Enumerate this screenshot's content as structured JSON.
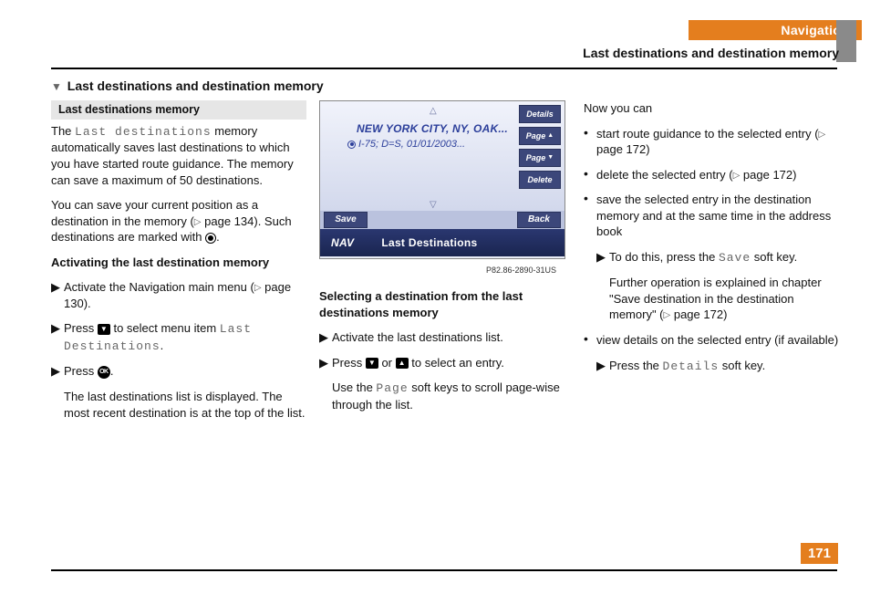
{
  "header": {
    "nav": "Navigation",
    "sub": "Last destinations and destination memory"
  },
  "section_title": "Last destinations and destination memory",
  "col1": {
    "subhead": "Last destinations memory",
    "p1_a": "The ",
    "p1_mono": "Last destinations",
    "p1_b": " memory automatically saves last destinations to which you have started route guidance. The memory can save a maximum of 50 destinations.",
    "p2_a": "You can save your current position as a destination in the memory (",
    "p2_page": "page 134",
    "p2_b": "). Such destinations are marked with ",
    "h2": "Activating the last destination memory",
    "s1_a": "Activate the Navigation main menu (",
    "s1_page": "page 130",
    "s1_b": ").",
    "s2_a": "Press ",
    "s2_b": " to select menu item ",
    "s2_mono": "Last Destinations",
    "s3_a": "Press ",
    "s4": "The last destinations list is displayed. The most recent destination is at the top of the list."
  },
  "fig": {
    "line1": "NEW YORK CITY, NY, OAK...",
    "line2": "I-75; D=S, 01/01/2003...",
    "k_details": "Details",
    "k_pageup": "Page",
    "k_pagedn": "Page",
    "k_delete": "Delete",
    "k_save": "Save",
    "k_back": "Back",
    "nav": "NAV",
    "title": "Last Destinations",
    "caption": "P82.86-2890-31US"
  },
  "col2": {
    "h": "Selecting a destination from the last destinations memory",
    "s1": "Activate the last destinations list.",
    "s2_a": "Press ",
    "s2_b": " or ",
    "s2_c": " to select an entry.",
    "s3_a": "Use the ",
    "s3_mono": "Page",
    "s3_b": " soft keys to scroll page-wise through the list."
  },
  "col3": {
    "intro": "Now you can",
    "b1_a": "start route guidance to the selected entry (",
    "b1_page": "page 172",
    "b1_b": ")",
    "b2_a": "delete the selected entry (",
    "b2_page": "page 172",
    "b2_b": ")",
    "b3": "save the selected entry in the destination memory and at the same time in the address book",
    "b3s_a": "To do this, press the ",
    "b3s_mono": "Save",
    "b3s_b": " soft key.",
    "b3p_a": "Further operation is explained in chapter \"Save destination in the destination memory\" (",
    "b3p_page": "page 172",
    "b3p_b": ")",
    "b4": "view details on the selected entry (if available)",
    "b4s_a": "Press the ",
    "b4s_mono": "Details",
    "b4s_b": " soft key."
  },
  "page_number": "171"
}
